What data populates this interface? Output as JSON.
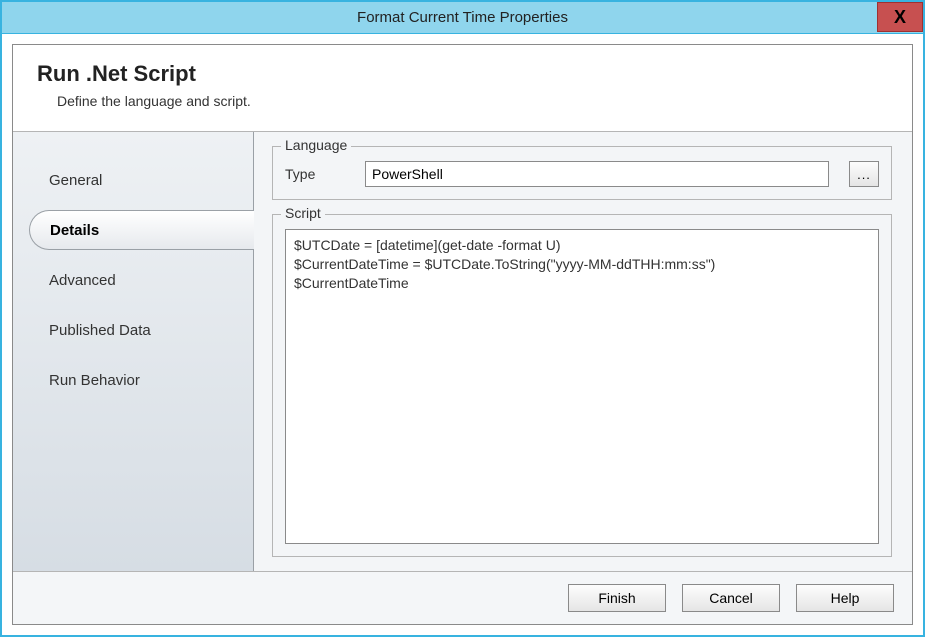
{
  "titlebar": {
    "title": "Format Current Time Properties",
    "close_label": "X"
  },
  "header": {
    "heading": "Run .Net Script",
    "subheading": "Define the language and script."
  },
  "sidebar": {
    "tabs": [
      {
        "label": "General"
      },
      {
        "label": "Details"
      },
      {
        "label": "Advanced"
      },
      {
        "label": "Published Data"
      },
      {
        "label": "Run Behavior"
      }
    ],
    "active_index": 1
  },
  "content": {
    "language": {
      "group_label": "Language",
      "type_label": "Type",
      "type_value": "PowerShell",
      "browse_label": "..."
    },
    "script": {
      "group_label": "Script",
      "value": "$UTCDate = [datetime](get-date -format U)\n$CurrentDateTime = $UTCDate.ToString(\"yyyy-MM-ddTHH:mm:ss\")\n$CurrentDateTime"
    }
  },
  "footer": {
    "finish": "Finish",
    "cancel": "Cancel",
    "help": "Help"
  }
}
